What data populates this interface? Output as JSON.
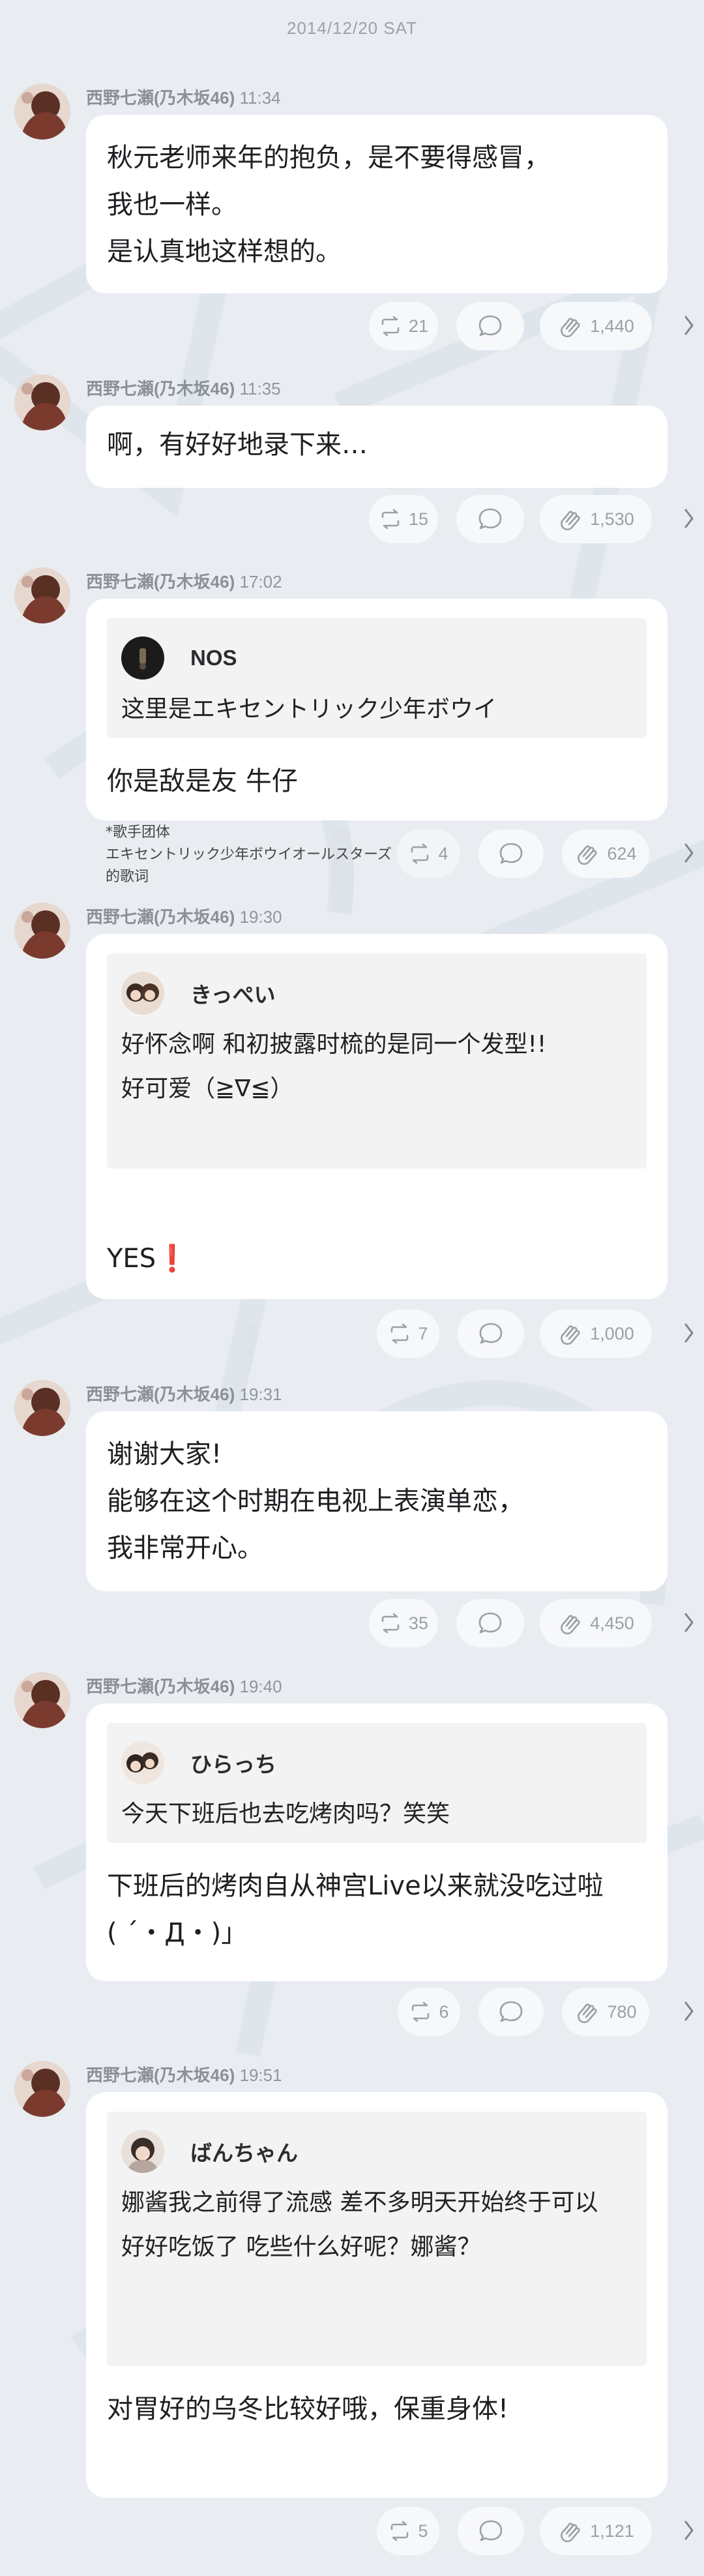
{
  "date_header": "2014/12/20 SAT",
  "colors": {
    "background": "#e9edf2",
    "bubble": "#ffffff",
    "quote_bg": "#f3f3f3",
    "meta_text": "#8f969e",
    "exclamation": "#e0403c"
  },
  "posts": [
    {
      "author": "西野七瀬(乃木坂46)",
      "time": "11:34",
      "text": "秋元老师来年的抱负，是不要得感冒，\n我也一样。\n是认真地这样想的。",
      "repost_count": "21",
      "like_count": "1,440"
    },
    {
      "author": "西野七瀬(乃木坂46)",
      "time": "11:35",
      "text": "啊，有好好地录下来…",
      "repost_count": "15",
      "like_count": "1,530"
    },
    {
      "author": "西野七瀬(乃木坂46)",
      "time": "17:02",
      "quote": {
        "name": "NOS",
        "text": "这里是エキセントリック少年ボウイ"
      },
      "text": "你是敌是友 牛仔",
      "repost_count": "4",
      "like_count": "624",
      "footnote": "*歌手团体\nエキセントリック少年ボウイオールスターズ\n的歌词"
    },
    {
      "author": "西野七瀬(乃木坂46)",
      "time": "19:30",
      "quote": {
        "name": "きっぺい",
        "text": "好怀念啊 和初披露时梳的是同一个发型!!\n好可爱（≧∇≦）"
      },
      "text": "YES",
      "text_emoji": "❗",
      "repost_count": "7",
      "like_count": "1,000"
    },
    {
      "author": "西野七瀬(乃木坂46)",
      "time": "19:31",
      "text": "谢谢大家!\n能够在这个时期在电视上表演单恋，\n我非常开心。",
      "repost_count": "35",
      "like_count": "4,450"
    },
    {
      "author": "西野七瀬(乃木坂46)",
      "time": "19:40",
      "quote": {
        "name": "ひらっち",
        "text": "今天下班后也去吃烤肉吗？笑笑"
      },
      "text": "下班后的烤肉自从神宫Live以来就没吃过啦\n( ´・Д・)」",
      "repost_count": "6",
      "like_count": "780"
    },
    {
      "author": "西野七瀬(乃木坂46)",
      "time": "19:51",
      "quote": {
        "name": "ばんちゃん",
        "text": "娜酱我之前得了流感 差不多明天开始终于可以\n好好吃饭了 吃些什么好呢？娜酱？"
      },
      "text": "对胃好的乌冬比较好哦，保重身体!",
      "repost_count": "5",
      "like_count": "1,121"
    }
  ]
}
